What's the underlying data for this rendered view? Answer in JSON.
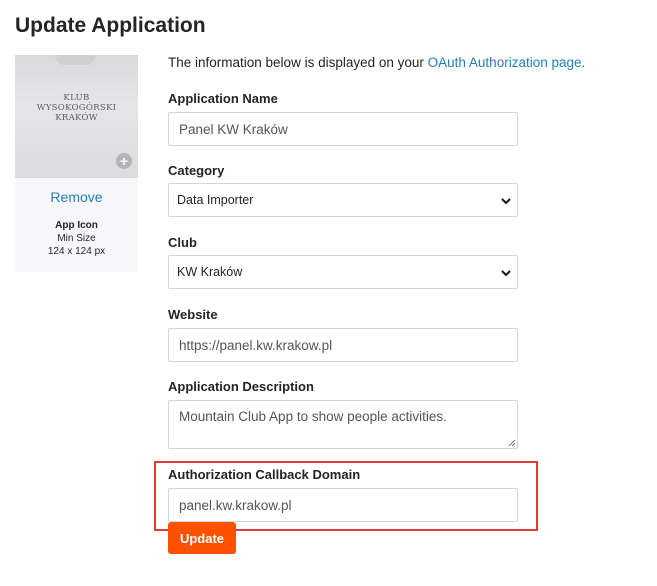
{
  "page": {
    "title": "Update Application"
  },
  "app_icon": {
    "logo_lines": [
      "KLUB",
      "WYSOKOGÓRSKI",
      "KRAKÓW"
    ],
    "remove_label": "Remove",
    "caption": "App Icon",
    "min_size_label": "Min Size",
    "size_value": "124 x 124 px"
  },
  "info": {
    "text": "The information below is displayed on your ",
    "link_text": "OAuth Authorization page."
  },
  "form": {
    "application_name": {
      "label": "Application Name",
      "value": "Panel KW Kraków"
    },
    "category": {
      "label": "Category",
      "selected": "Data Importer"
    },
    "club": {
      "label": "Club",
      "selected": "KW Kraków"
    },
    "website": {
      "label": "Website",
      "value": "https://panel.kw.krakow.pl"
    },
    "description": {
      "label": "Application Description",
      "value": "Mountain Club App to show people activities."
    },
    "callback_domain": {
      "label": "Authorization Callback Domain",
      "value": "panel.kw.krakow.pl"
    }
  },
  "actions": {
    "update_label": "Update"
  },
  "colors": {
    "accent": "#fc5200",
    "link": "#1e7fb5",
    "highlight": "#e53935"
  }
}
